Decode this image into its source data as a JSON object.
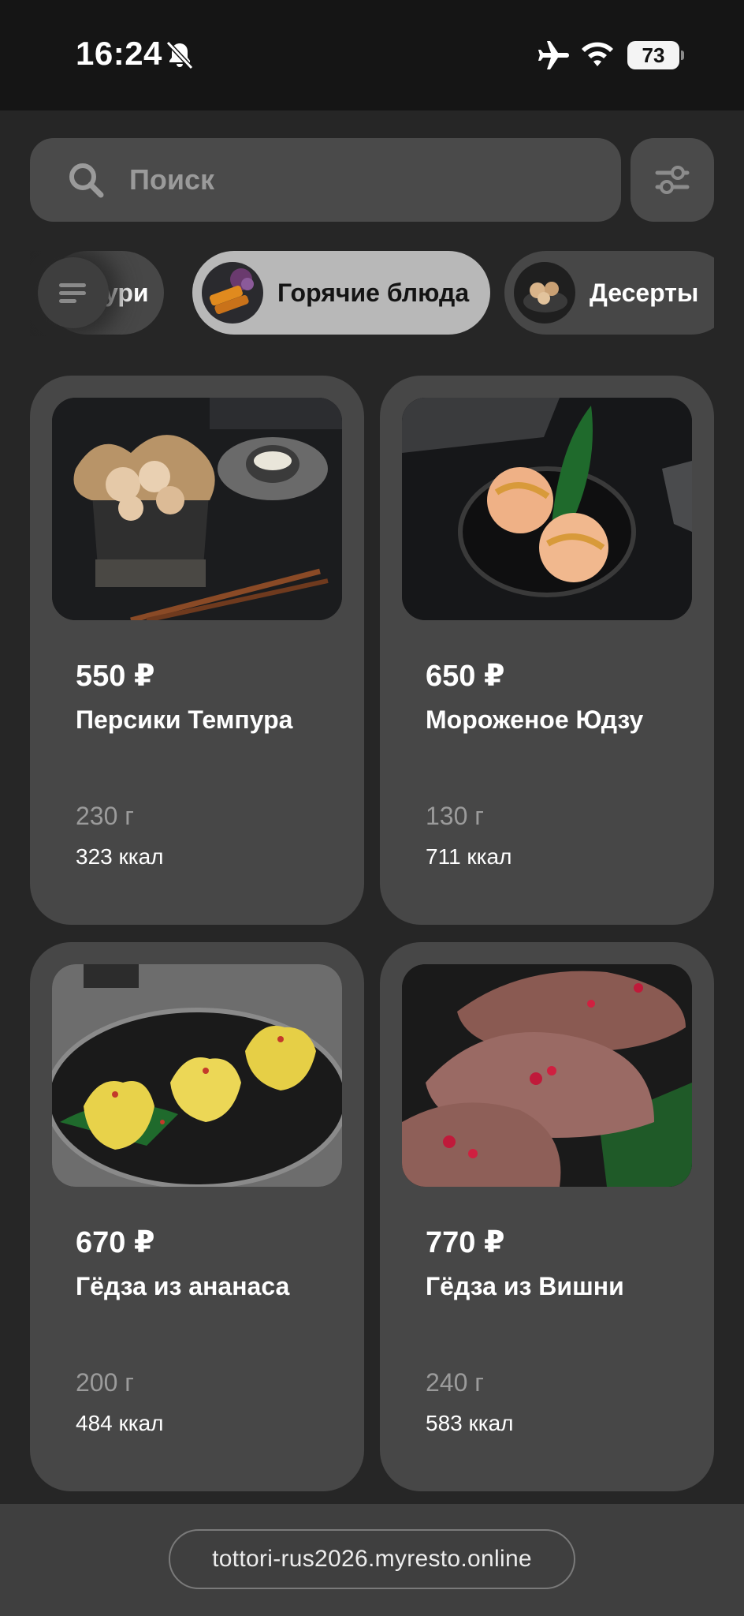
{
  "status_bar": {
    "time": "16:24",
    "battery": "73",
    "icons": [
      "bell-slash-icon",
      "airplane-icon",
      "wifi-icon",
      "battery-icon"
    ]
  },
  "search": {
    "placeholder": "Поиск"
  },
  "categories": [
    {
      "label": "ури",
      "active": false
    },
    {
      "label": "Горячие блюда",
      "active": true
    },
    {
      "label": "Десерты",
      "active": false
    }
  ],
  "products": [
    {
      "price": "550 ₽",
      "name": "Персики Темпура",
      "weight": "230 г",
      "kcal": "323 ккал"
    },
    {
      "price": "650 ₽",
      "name": "Мороженое Юдзу",
      "weight": "130 г",
      "kcal": "711 ккал"
    },
    {
      "price": "670 ₽",
      "name": "Гёдза из ананаса",
      "weight": "200 г",
      "kcal": "484 ккал"
    },
    {
      "price": "770 ₽",
      "name": "Гёдза из Вишни",
      "weight": "240 г",
      "kcal": "583 ккал"
    }
  ],
  "footer": {
    "url": "tottori-rus2026.myresto.online"
  },
  "colors": {
    "background": "#262626",
    "card": "#474747",
    "active_chip": "#b8b8b8",
    "status_bar": "#151515"
  }
}
